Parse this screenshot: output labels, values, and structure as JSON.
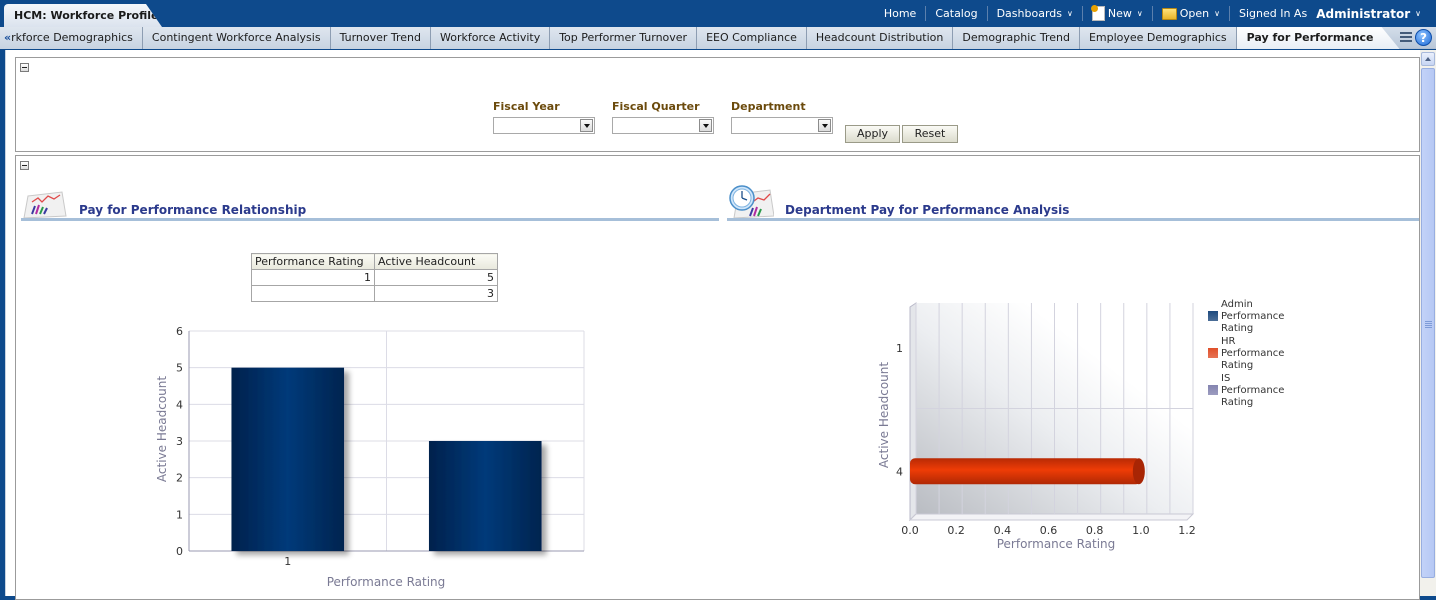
{
  "app": {
    "title": "HCM: Workforce Profile"
  },
  "global_nav": {
    "home": "Home",
    "catalog": "Catalog",
    "dashboards": "Dashboards",
    "new": "New",
    "open": "Open",
    "signed_in_as": "Signed In As",
    "user": "Administrator"
  },
  "tabs": [
    {
      "label": "rkforce Demographics",
      "active": false
    },
    {
      "label": "Contingent Workforce Analysis",
      "active": false
    },
    {
      "label": "Turnover Trend",
      "active": false
    },
    {
      "label": "Workforce Activity",
      "active": false
    },
    {
      "label": "Top Performer Turnover",
      "active": false
    },
    {
      "label": "EEO Compliance",
      "active": false
    },
    {
      "label": "Headcount Distribution",
      "active": false
    },
    {
      "label": "Demographic Trend",
      "active": false
    },
    {
      "label": "Employee Demographics",
      "active": false
    },
    {
      "label": "Pay for Performance",
      "active": true
    }
  ],
  "tab_scroll_left": "«",
  "help_icon": "?",
  "prompts": {
    "fiscal_year": {
      "label": "Fiscal Year",
      "value": ""
    },
    "fiscal_quarter": {
      "label": "Fiscal Quarter",
      "value": ""
    },
    "department": {
      "label": "Department",
      "value": ""
    },
    "apply": "Apply",
    "reset": "Reset"
  },
  "left_view": {
    "title": "Pay for Performance Relationship",
    "table": {
      "headers": [
        "Performance Rating",
        "Active Headcount"
      ],
      "rows": [
        [
          "1",
          "5"
        ],
        [
          "",
          "3"
        ]
      ]
    }
  },
  "right_view": {
    "title": "Department Pay for Performance Analysis"
  },
  "colors": {
    "bar_navy": "#06326a",
    "bar_red": "#e23a0a",
    "legend_admin": "#1e4a7e",
    "legend_hr": "#e0502a",
    "legend_is": "#8484b0",
    "title_blue": "#2b3a8c",
    "prompt_label": "#6b4a0c"
  },
  "chart_data": [
    {
      "type": "bar",
      "title": "Pay for Performance Relationship",
      "categories": [
        "1",
        ""
      ],
      "values": [
        5,
        3
      ],
      "xlabel": "Performance Rating",
      "ylabel": "Active Headcount",
      "ylim": [
        0,
        6
      ],
      "yticks": [
        "0",
        "1",
        "2",
        "3",
        "4",
        "5",
        "6"
      ],
      "grid": true,
      "legend": "none"
    },
    {
      "type": "bar",
      "orientation": "horizontal",
      "title": "Department Pay for Performance Analysis",
      "categories": [
        "1",
        "4"
      ],
      "series": [
        {
          "name": "Admin Performance Rating",
          "values": [
            null,
            null
          ]
        },
        {
          "name": "HR Performance Rating",
          "values": [
            null,
            1.0
          ]
        },
        {
          "name": "IS Performance Rating",
          "values": [
            null,
            null
          ]
        }
      ],
      "xlabel": "Performance Rating",
      "ylabel": "Active Headcount",
      "xlim": [
        0,
        1.2
      ],
      "xticks": [
        "0.0",
        "0.2",
        "0.4",
        "0.6",
        "0.8",
        "1.0",
        "1.2"
      ],
      "grid": true,
      "legend": "right"
    }
  ]
}
